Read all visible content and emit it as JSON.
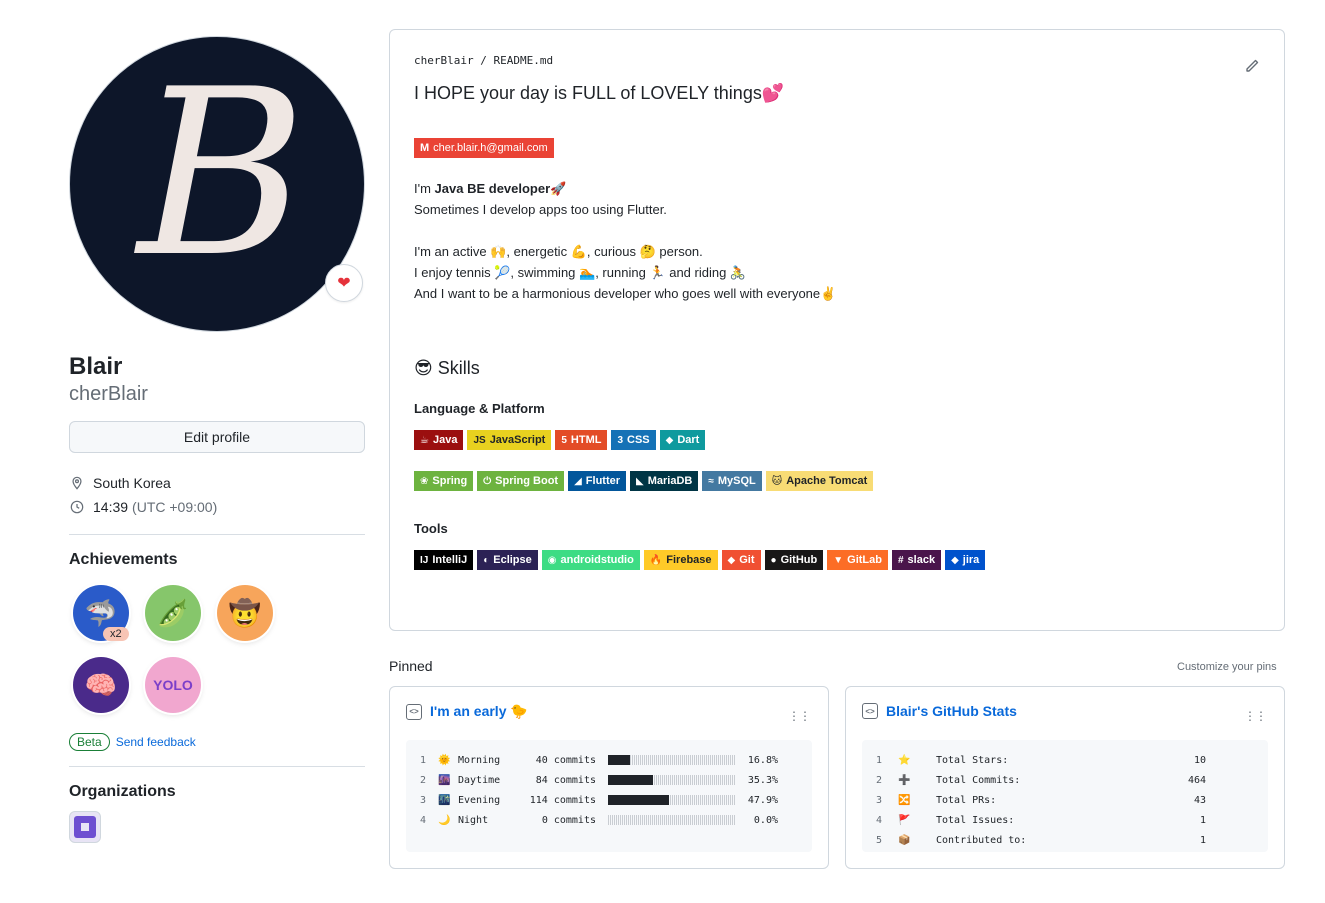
{
  "profile": {
    "avatar_letter": "B",
    "name": "Blair",
    "login": "cherBlair",
    "edit_label": "Edit profile",
    "location": "South Korea",
    "time": "14:39",
    "timezone": "(UTC +09:00)"
  },
  "achievements": {
    "title": "Achievements",
    "badges": [
      {
        "icon": "🦈",
        "bg": "#2a5bc9",
        "tier": "x2"
      },
      {
        "icon": "🫛",
        "bg": "#86c66b"
      },
      {
        "icon": "🤠",
        "bg": "#f7a55b"
      },
      {
        "icon": "🧠",
        "bg": "#4a2a8a"
      },
      {
        "icon": "YOLO",
        "bg": "#f1a7cf"
      }
    ],
    "beta_label": "Beta",
    "feedback_label": "Send feedback"
  },
  "organizations": {
    "title": "Organizations"
  },
  "readme": {
    "owner": "cherBlair",
    "sep": "/",
    "file": "README.md",
    "headline": "I HOPE your day is FULL of LOVELY things💕",
    "email": "cher.blair.h@gmail.com",
    "intro_1_pre": "I'm ",
    "intro_1_bold": "Java BE developer",
    "intro_1_post": "🚀",
    "intro_2": "Sometimes I develop apps too using Flutter.",
    "line_1": "I'm an active 🙌, energetic 💪, curious 🤔 person.",
    "line_2": "I enjoy tennis 🎾, swimming 🏊, running 🏃 and riding 🚴",
    "line_3": "And I want to be a harmonious developer who goes well with everyone✌️",
    "skills_title": "😎 Skills",
    "lang_title": "Language & Platform",
    "tools_title": "Tools",
    "langs": [
      {
        "label": "Java",
        "icon": "☕",
        "bg": "#9b0f0f",
        "fg": "#ffffff"
      },
      {
        "label": "JavaScript",
        "icon": "JS",
        "bg": "#e8d11f",
        "fg": "#1f2328"
      },
      {
        "label": "HTML",
        "icon": "5",
        "bg": "#e34c26",
        "fg": "#ffffff"
      },
      {
        "label": "CSS",
        "icon": "3",
        "bg": "#1572b6",
        "fg": "#ffffff"
      },
      {
        "label": "Dart",
        "icon": "◆",
        "bg": "#0f9a9e",
        "fg": "#ffffff"
      }
    ],
    "platforms": [
      {
        "label": "Spring",
        "icon": "❀",
        "bg": "#6db33f",
        "fg": "#ffffff"
      },
      {
        "label": "Spring Boot",
        "icon": "⏻",
        "bg": "#6db33f",
        "fg": "#ffffff"
      },
      {
        "label": "Flutter",
        "icon": "◢",
        "bg": "#02569b",
        "fg": "#ffffff"
      },
      {
        "label": "MariaDB",
        "icon": "◣",
        "bg": "#003545",
        "fg": "#ffffff"
      },
      {
        "label": "MySQL",
        "icon": "≈",
        "bg": "#4479a1",
        "fg": "#ffffff"
      },
      {
        "label": "Apache Tomcat",
        "icon": "🐱",
        "bg": "#f8dc75",
        "fg": "#1f2328"
      }
    ],
    "tools": [
      {
        "label": "IntelliJ",
        "icon": "IJ",
        "bg": "#000000",
        "fg": "#ffffff"
      },
      {
        "label": "Eclipse",
        "icon": "◐",
        "bg": "#2c2255",
        "fg": "#ffffff"
      },
      {
        "label": "androidstudio",
        "icon": "◉",
        "bg": "#3ddc84",
        "fg": "#ffffff"
      },
      {
        "label": "Firebase",
        "icon": "🔥",
        "bg": "#ffca28",
        "fg": "#1f2328"
      },
      {
        "label": "Git",
        "icon": "◆",
        "bg": "#f05032",
        "fg": "#ffffff"
      },
      {
        "label": "GitHub",
        "icon": "●",
        "bg": "#181717",
        "fg": "#ffffff"
      },
      {
        "label": "GitLab",
        "icon": "▼",
        "bg": "#fc6d26",
        "fg": "#ffffff"
      },
      {
        "label": "slack",
        "icon": "#",
        "bg": "#4a154b",
        "fg": "#ffffff"
      },
      {
        "label": "jira",
        "icon": "◆",
        "bg": "#0052cc",
        "fg": "#ffffff"
      }
    ]
  },
  "pinned": {
    "title": "Pinned",
    "customize_label": "Customize your pins",
    "card1": {
      "title": "I'm an early 🐤",
      "rows": [
        {
          "n": "1",
          "icon": "🌞",
          "label": "Morning",
          "commits": "40 commits",
          "fraction": 0.168,
          "pct": "16.8%"
        },
        {
          "n": "2",
          "icon": "🌆",
          "label": "Daytime",
          "commits": "84 commits",
          "fraction": 0.353,
          "pct": "35.3%"
        },
        {
          "n": "3",
          "icon": "🌃",
          "label": "Evening",
          "commits": "114 commits",
          "fraction": 0.479,
          "pct": "47.9%"
        },
        {
          "n": "4",
          "icon": "🌙",
          "label": "Night",
          "commits": "0 commits",
          "fraction": 0.0,
          "pct": "0.0%"
        }
      ]
    },
    "card2": {
      "title": "Blair's GitHub Stats",
      "rows": [
        {
          "n": "1",
          "icon": "⭐",
          "label": "Total Stars:",
          "value": "10"
        },
        {
          "n": "2",
          "icon": "➕",
          "label": "Total Commits:",
          "value": "464"
        },
        {
          "n": "3",
          "icon": "🔀",
          "label": "Total PRs:",
          "value": "43"
        },
        {
          "n": "4",
          "icon": "🚩",
          "label": "Total Issues:",
          "value": "1"
        },
        {
          "n": "5",
          "icon": "📦",
          "label": "Contributed to:",
          "value": "1"
        }
      ]
    }
  },
  "colors": {
    "link": "#0969da",
    "heart": "#e5323b",
    "avatar_bg": "#0d1629"
  }
}
